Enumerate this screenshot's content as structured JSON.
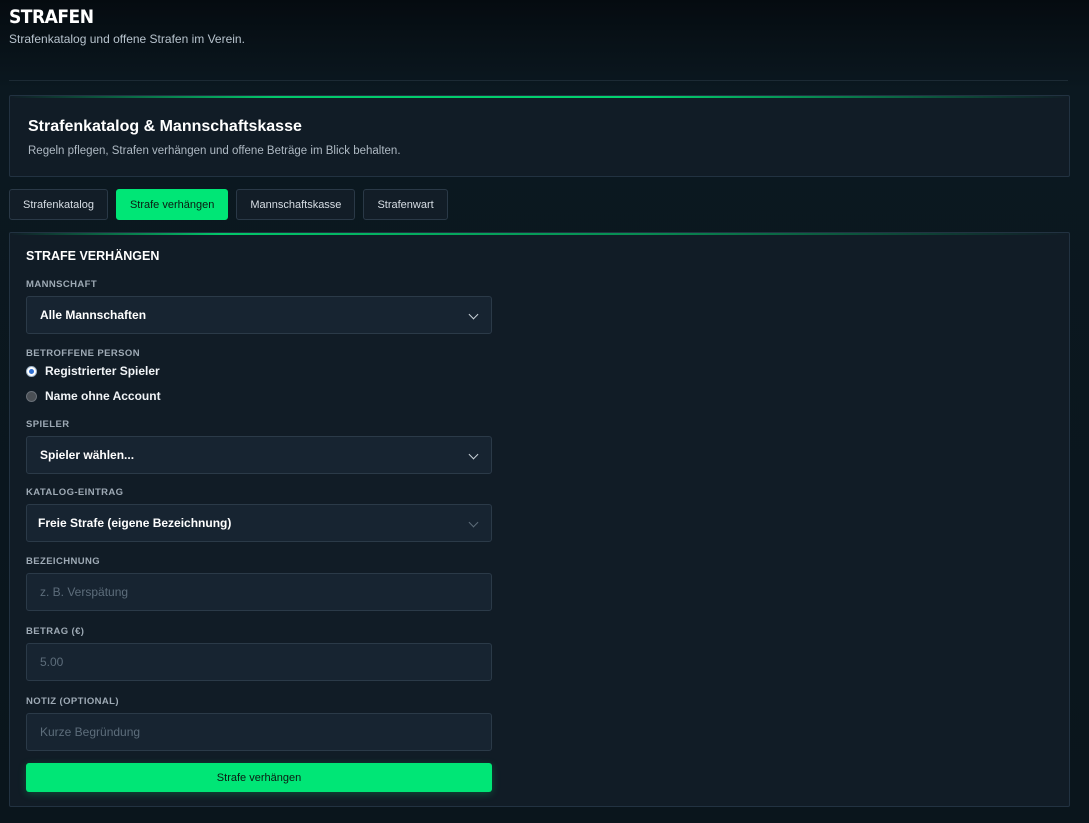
{
  "header": {
    "title": "STRAFEN",
    "subtitle": "Strafenkatalog und offene Strafen im Verein."
  },
  "hero": {
    "title": "Strafenkatalog & Mannschaftskasse",
    "description": "Regeln pflegen, Strafen verhängen und offene Beträge im Blick behalten."
  },
  "tabs": [
    {
      "label": "Strafenkatalog",
      "active": false
    },
    {
      "label": "Strafe verhängen",
      "active": true
    },
    {
      "label": "Mannschaftskasse",
      "active": false
    },
    {
      "label": "Strafenwart",
      "active": false
    }
  ],
  "form": {
    "section_title": "STRAFE VERHÄNGEN",
    "team": {
      "label": "MANNSCHAFT",
      "value": "Alle Mannschaften"
    },
    "person": {
      "label": "BETROFFENE PERSON",
      "options": [
        {
          "label": "Registrierter Spieler",
          "selected": true
        },
        {
          "label": "Name ohne Account",
          "selected": false
        }
      ]
    },
    "player": {
      "label": "SPIELER",
      "value": "Spieler wählen..."
    },
    "catalog": {
      "label": "KATALOG-EINTRAG",
      "value": "Freie Strafe (eigene Bezeichnung)"
    },
    "designation": {
      "label": "BEZEICHNUNG",
      "placeholder": "z. B. Verspätung"
    },
    "amount": {
      "label": "BETRAG (€)",
      "placeholder": "5.00"
    },
    "note": {
      "label": "NOTIZ (OPTIONAL)",
      "placeholder": "Kurze Begründung"
    },
    "submit_label": "Strafe verhängen"
  },
  "colors": {
    "accent": "#00e676",
    "background": "#0a141b",
    "panel": "#111c26"
  }
}
